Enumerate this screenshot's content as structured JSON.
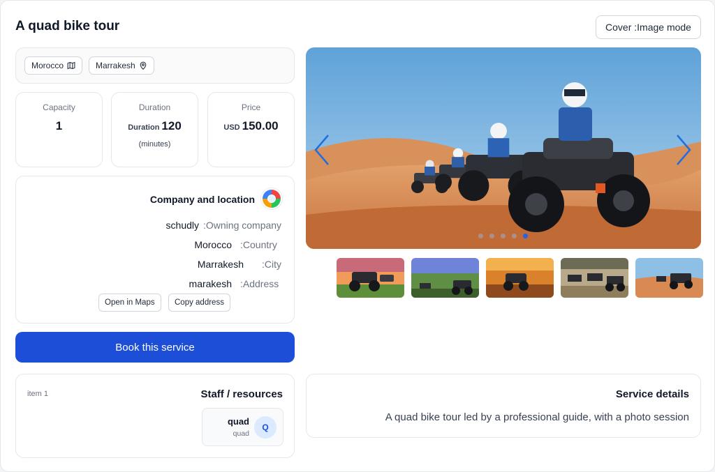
{
  "header": {
    "title": "A quad bike tour",
    "mode_button": "Cover  :Image mode"
  },
  "location_chips": [
    {
      "label": "Morocco",
      "icon": "map-icon"
    },
    {
      "label": "Marrakesh",
      "icon": "location-pin-icon"
    }
  ],
  "stats": {
    "capacity": {
      "label": "Capacity",
      "value": "1"
    },
    "duration": {
      "label": "Duration",
      "prefix": "Duration",
      "value": "120",
      "unit": "(minutes)"
    },
    "price": {
      "label": "Price",
      "currency": "USD",
      "value": "150.00"
    }
  },
  "company": {
    "title": "Company and location",
    "rows": [
      {
        "value": "schudly",
        "key": ":Owning company"
      },
      {
        "value": "Morocco",
        "key": ":Country"
      },
      {
        "value": "Marrakesh",
        "key": ":City"
      },
      {
        "value": "marakesh",
        "key": ":Address"
      }
    ],
    "open_maps": "Open in Maps",
    "copy_address": "Copy address"
  },
  "book_button": "Book this service",
  "staff": {
    "item_label": "item 1",
    "title": "Staff / resources",
    "resource_name": "quad",
    "resource_type": "quad",
    "resource_initial": "Q"
  },
  "details": {
    "title": "Service details",
    "description": "A quad bike tour led by a professional guide, with a photo session"
  },
  "carousel": {
    "slide_count": 5,
    "active_index": 4,
    "thumbnail_count": 5
  },
  "colors": {
    "primary": "#1d4ed8",
    "arrow": "#1d6fe0",
    "sky": "#8ec0e6",
    "sand": "#d98a52"
  }
}
